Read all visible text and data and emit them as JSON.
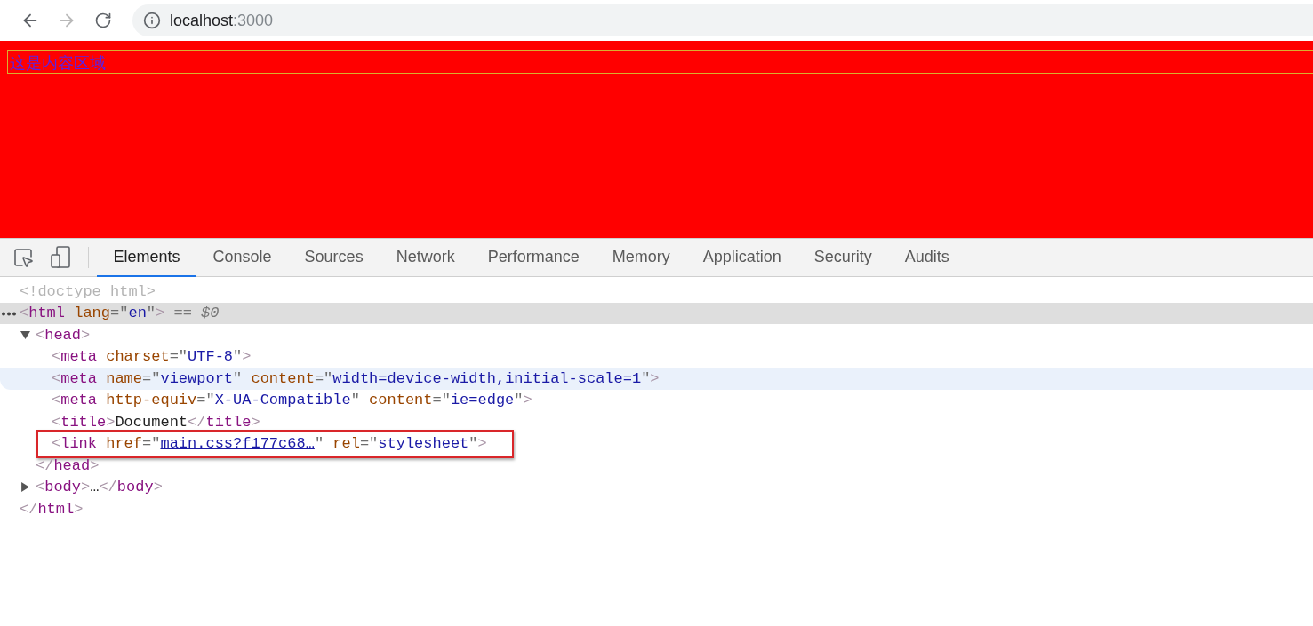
{
  "browser": {
    "buttons": [
      {
        "kind": "back",
        "disabled": false
      },
      {
        "kind": "forward",
        "disabled": true
      },
      {
        "kind": "reload",
        "disabled": false
      }
    ],
    "address": {
      "host": "localhost",
      "port": ":3000"
    }
  },
  "page": {
    "content_text": "这是内容区域"
  },
  "devtools": {
    "tools": [
      {
        "kind": "inspect"
      },
      {
        "kind": "device"
      }
    ],
    "tabs": [
      {
        "label": "Elements",
        "selected": true
      },
      {
        "label": "Console",
        "selected": false
      },
      {
        "label": "Sources",
        "selected": false
      },
      {
        "label": "Network",
        "selected": false
      },
      {
        "label": "Performance",
        "selected": false
      },
      {
        "label": "Memory",
        "selected": false
      },
      {
        "label": "Application",
        "selected": false
      },
      {
        "label": "Security",
        "selected": false
      },
      {
        "label": "Audits",
        "selected": false
      }
    ],
    "tree": [
      {
        "open": [
          {
            "kind": "doctype",
            "text": "<!doctype html>"
          }
        ],
        "selected": false,
        "hovered": false,
        "annotated": false
      },
      {
        "open": [
          {
            "kind": "bracket",
            "text": "<"
          },
          {
            "kind": "tag",
            "text": "html"
          },
          {
            "kind": "attr",
            "text": " lang"
          },
          {
            "kind": "punct",
            "text": "=\""
          },
          {
            "kind": "value",
            "text": "en"
          },
          {
            "kind": "punct",
            "text": "\""
          },
          {
            "kind": "bracket",
            "text": ">"
          },
          {
            "kind": "marker",
            "text": " == $0"
          }
        ],
        "selected": true,
        "hovered": false,
        "annotated": false,
        "children": [
          {
            "open": [
              {
                "kind": "bracket",
                "text": "<"
              },
              {
                "kind": "tag",
                "text": "head"
              },
              {
                "kind": "bracket",
                "text": ">"
              }
            ],
            "expanded": true,
            "selected": false,
            "hovered": false,
            "annotated": false,
            "children": [
              {
                "open": [
                  {
                    "kind": "bracket",
                    "text": "<"
                  },
                  {
                    "kind": "tag",
                    "text": "meta"
                  },
                  {
                    "kind": "attr",
                    "text": " charset"
                  },
                  {
                    "kind": "punct",
                    "text": "=\""
                  },
                  {
                    "kind": "value",
                    "text": "UTF-8"
                  },
                  {
                    "kind": "punct",
                    "text": "\""
                  },
                  {
                    "kind": "bracket",
                    "text": ">"
                  }
                ],
                "selected": false,
                "hovered": false,
                "annotated": false
              },
              {
                "open": [
                  {
                    "kind": "bracket",
                    "text": "<"
                  },
                  {
                    "kind": "tag",
                    "text": "meta"
                  },
                  {
                    "kind": "attr",
                    "text": " name"
                  },
                  {
                    "kind": "punct",
                    "text": "=\""
                  },
                  {
                    "kind": "value",
                    "text": "viewport"
                  },
                  {
                    "kind": "punct",
                    "text": "\""
                  },
                  {
                    "kind": "attr",
                    "text": " content"
                  },
                  {
                    "kind": "punct",
                    "text": "=\""
                  },
                  {
                    "kind": "value",
                    "text": "width=device-width,initial-scale=1"
                  },
                  {
                    "kind": "punct",
                    "text": "\""
                  },
                  {
                    "kind": "bracket",
                    "text": ">"
                  }
                ],
                "selected": false,
                "hovered": true,
                "annotated": false
              },
              {
                "open": [
                  {
                    "kind": "bracket",
                    "text": "<"
                  },
                  {
                    "kind": "tag",
                    "text": "meta"
                  },
                  {
                    "kind": "attr",
                    "text": " http-equiv"
                  },
                  {
                    "kind": "punct",
                    "text": "=\""
                  },
                  {
                    "kind": "value",
                    "text": "X-UA-Compatible"
                  },
                  {
                    "kind": "punct",
                    "text": "\""
                  },
                  {
                    "kind": "attr",
                    "text": " content"
                  },
                  {
                    "kind": "punct",
                    "text": "=\""
                  },
                  {
                    "kind": "value",
                    "text": "ie=edge"
                  },
                  {
                    "kind": "punct",
                    "text": "\""
                  },
                  {
                    "kind": "bracket",
                    "text": ">"
                  }
                ],
                "selected": false,
                "hovered": false,
                "annotated": false
              },
              {
                "open": [
                  {
                    "kind": "bracket",
                    "text": "<"
                  },
                  {
                    "kind": "tag",
                    "text": "title"
                  },
                  {
                    "kind": "bracket",
                    "text": ">"
                  },
                  {
                    "kind": "text",
                    "text": "Document"
                  },
                  {
                    "kind": "bracket",
                    "text": "</"
                  },
                  {
                    "kind": "tag",
                    "text": "title"
                  },
                  {
                    "kind": "bracket",
                    "text": ">"
                  }
                ],
                "selected": false,
                "hovered": false,
                "annotated": false
              },
              {
                "open": [
                  {
                    "kind": "bracket",
                    "text": "<"
                  },
                  {
                    "kind": "tag",
                    "text": "link"
                  },
                  {
                    "kind": "attr",
                    "text": " href"
                  },
                  {
                    "kind": "punct",
                    "text": "=\""
                  },
                  {
                    "kind": "link",
                    "text": "main.css?f177c68…"
                  },
                  {
                    "kind": "punct",
                    "text": "\""
                  },
                  {
                    "kind": "attr",
                    "text": " rel"
                  },
                  {
                    "kind": "punct",
                    "text": "=\""
                  },
                  {
                    "kind": "value",
                    "text": "stylesheet"
                  },
                  {
                    "kind": "punct",
                    "text": "\""
                  },
                  {
                    "kind": "bracket",
                    "text": ">"
                  }
                ],
                "selected": false,
                "hovered": false,
                "annotated": true
              }
            ],
            "close": [
              {
                "kind": "bracket",
                "text": "</"
              },
              {
                "kind": "tag",
                "text": "head"
              },
              {
                "kind": "bracket",
                "text": ">"
              }
            ]
          },
          {
            "open": [
              {
                "kind": "bracket",
                "text": "<"
              },
              {
                "kind": "tag",
                "text": "body"
              },
              {
                "kind": "bracket",
                "text": ">"
              },
              {
                "kind": "text",
                "text": "…"
              },
              {
                "kind": "bracket",
                "text": "</"
              },
              {
                "kind": "tag",
                "text": "body"
              },
              {
                "kind": "bracket",
                "text": ">"
              }
            ],
            "expanded": false,
            "selected": false,
            "hovered": false,
            "annotated": false
          }
        ],
        "close": [
          {
            "kind": "bracket",
            "text": "</"
          },
          {
            "kind": "tag",
            "text": "html"
          },
          {
            "kind": "bracket",
            "text": ">"
          }
        ]
      }
    ]
  }
}
